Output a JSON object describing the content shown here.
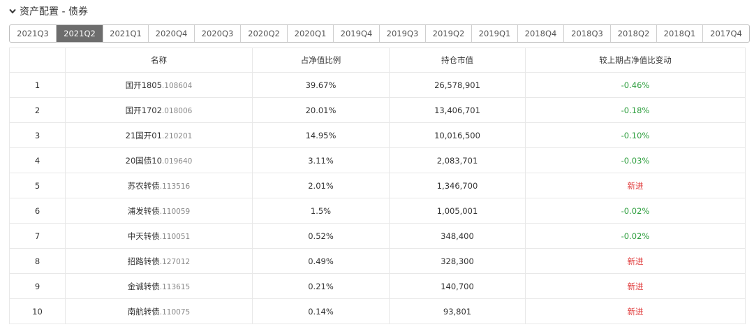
{
  "header": {
    "title": "资产配置 - 债券"
  },
  "tabs": [
    {
      "label": "2021Q3",
      "active": false
    },
    {
      "label": "2021Q2",
      "active": true
    },
    {
      "label": "2021Q1",
      "active": false
    },
    {
      "label": "2020Q4",
      "active": false
    },
    {
      "label": "2020Q3",
      "active": false
    },
    {
      "label": "2020Q2",
      "active": false
    },
    {
      "label": "2020Q1",
      "active": false
    },
    {
      "label": "2019Q4",
      "active": false
    },
    {
      "label": "2019Q3",
      "active": false
    },
    {
      "label": "2019Q2",
      "active": false
    },
    {
      "label": "2019Q1",
      "active": false
    },
    {
      "label": "2018Q4",
      "active": false
    },
    {
      "label": "2018Q3",
      "active": false
    },
    {
      "label": "2018Q2",
      "active": false
    },
    {
      "label": "2018Q1",
      "active": false
    },
    {
      "label": "2017Q4",
      "active": false
    }
  ],
  "table": {
    "columns": [
      "",
      "名称",
      "占净值比例",
      "持仓市值",
      "较上期占净值比变动"
    ],
    "rows": [
      {
        "index": "1",
        "name": "国开1805",
        "code": ".108604",
        "ratio": "39.67%",
        "value": "26,578,901",
        "change": "-0.46%",
        "change_type": "neg"
      },
      {
        "index": "2",
        "name": "国开1702",
        "code": ".018006",
        "ratio": "20.01%",
        "value": "13,406,701",
        "change": "-0.18%",
        "change_type": "neg"
      },
      {
        "index": "3",
        "name": "21国开01",
        "code": ".210201",
        "ratio": "14.95%",
        "value": "10,016,500",
        "change": "-0.10%",
        "change_type": "neg"
      },
      {
        "index": "4",
        "name": "20国债10",
        "code": ".019640",
        "ratio": "3.11%",
        "value": "2,083,701",
        "change": "-0.03%",
        "change_type": "neg"
      },
      {
        "index": "5",
        "name": "苏农转债",
        "code": ".113516",
        "ratio": "2.01%",
        "value": "1,346,700",
        "change": "新进",
        "change_type": "new"
      },
      {
        "index": "6",
        "name": "浦发转债",
        "code": ".110059",
        "ratio": "1.5%",
        "value": "1,005,001",
        "change": "-0.02%",
        "change_type": "neg"
      },
      {
        "index": "7",
        "name": "中天转债",
        "code": ".110051",
        "ratio": "0.52%",
        "value": "348,400",
        "change": "-0.02%",
        "change_type": "neg"
      },
      {
        "index": "8",
        "name": "招路转债",
        "code": ".127012",
        "ratio": "0.49%",
        "value": "328,300",
        "change": "新进",
        "change_type": "new"
      },
      {
        "index": "9",
        "name": "金诚转债",
        "code": ".113615",
        "ratio": "0.21%",
        "value": "140,700",
        "change": "新进",
        "change_type": "new"
      },
      {
        "index": "10",
        "name": "南航转债",
        "code": ".110075",
        "ratio": "0.14%",
        "value": "93,801",
        "change": "新进",
        "change_type": "new"
      }
    ]
  }
}
